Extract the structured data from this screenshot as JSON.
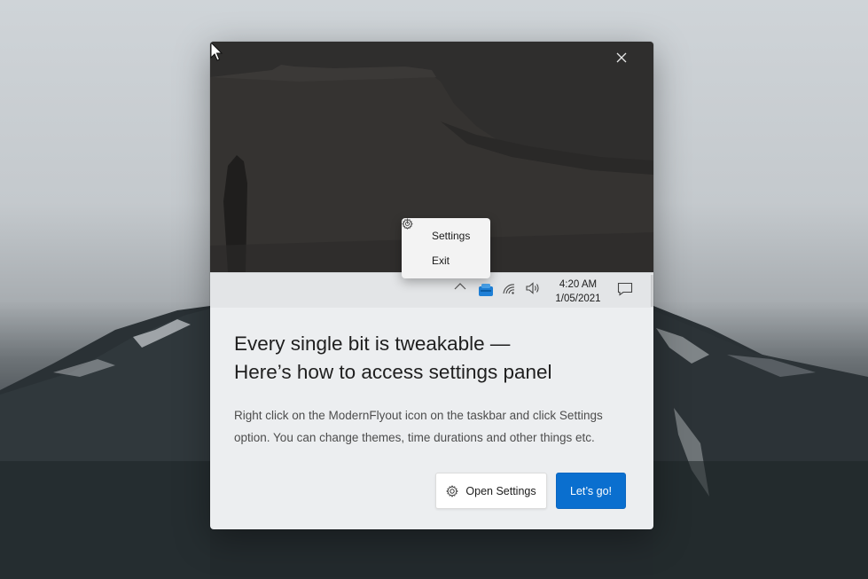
{
  "dialog": {
    "title_line1": "Every single bit is tweakable —",
    "title_line2": "Here’s how to access settings panel",
    "description": "Right click on the ModernFlyout icon on the taskbar and click Settings option. You can change themes, time durations and other things etc.",
    "buttons": {
      "open_settings": "Open Settings",
      "lets_go": "Let’s go!"
    }
  },
  "context_menu": {
    "items": [
      {
        "label": "Settings",
        "icon": "gear-icon"
      },
      {
        "label": "Exit",
        "icon": "power-icon"
      }
    ]
  },
  "taskbar": {
    "time": "4:20 AM",
    "date": "1/05/2021",
    "icons": [
      "chevron-up-icon",
      "modernflyout-app-icon",
      "wifi-icon",
      "volume-icon",
      "notification-icon"
    ]
  },
  "colors": {
    "accent": "#0a6fcf",
    "dialog_bg": "#eceef0",
    "hero_bg": "#2e2d2c"
  }
}
